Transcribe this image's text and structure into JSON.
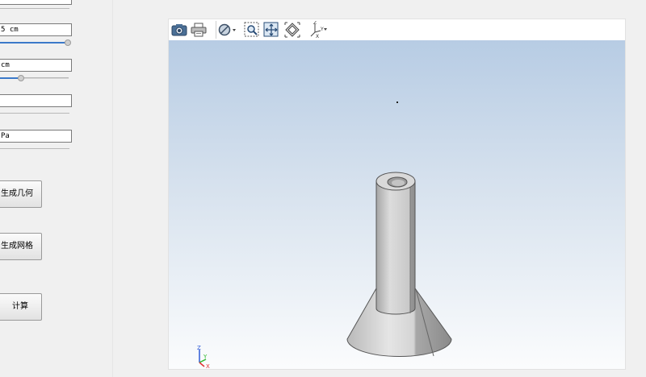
{
  "params": {
    "field1_value": "",
    "field2_value": "5 cm",
    "field3_value": "cm",
    "field4_value": "",
    "field5_value": "Pa",
    "slider1_level": 1.0,
    "slider2_level": 0.28
  },
  "buttons": {
    "generate_geometry": "生成几何",
    "generate_mesh": "生成网格",
    "compute": "计算"
  },
  "triad_labels": {
    "z": "Z",
    "y": "Y",
    "x": "X"
  },
  "colors": {
    "accent": "#3b79c9",
    "canvas_top": "#b7cce4",
    "canvas_bottom": "#fbfcfd",
    "axis_x": "#e03030",
    "axis_y": "#2eb82e",
    "axis_z": "#2f5bd7"
  },
  "toolbar_icons": [
    "camera-icon",
    "printer-icon",
    "view-style-icon",
    "zoom-window-icon",
    "fit-all-icon",
    "view-cube-icon",
    "axis-orientation-icon"
  ]
}
